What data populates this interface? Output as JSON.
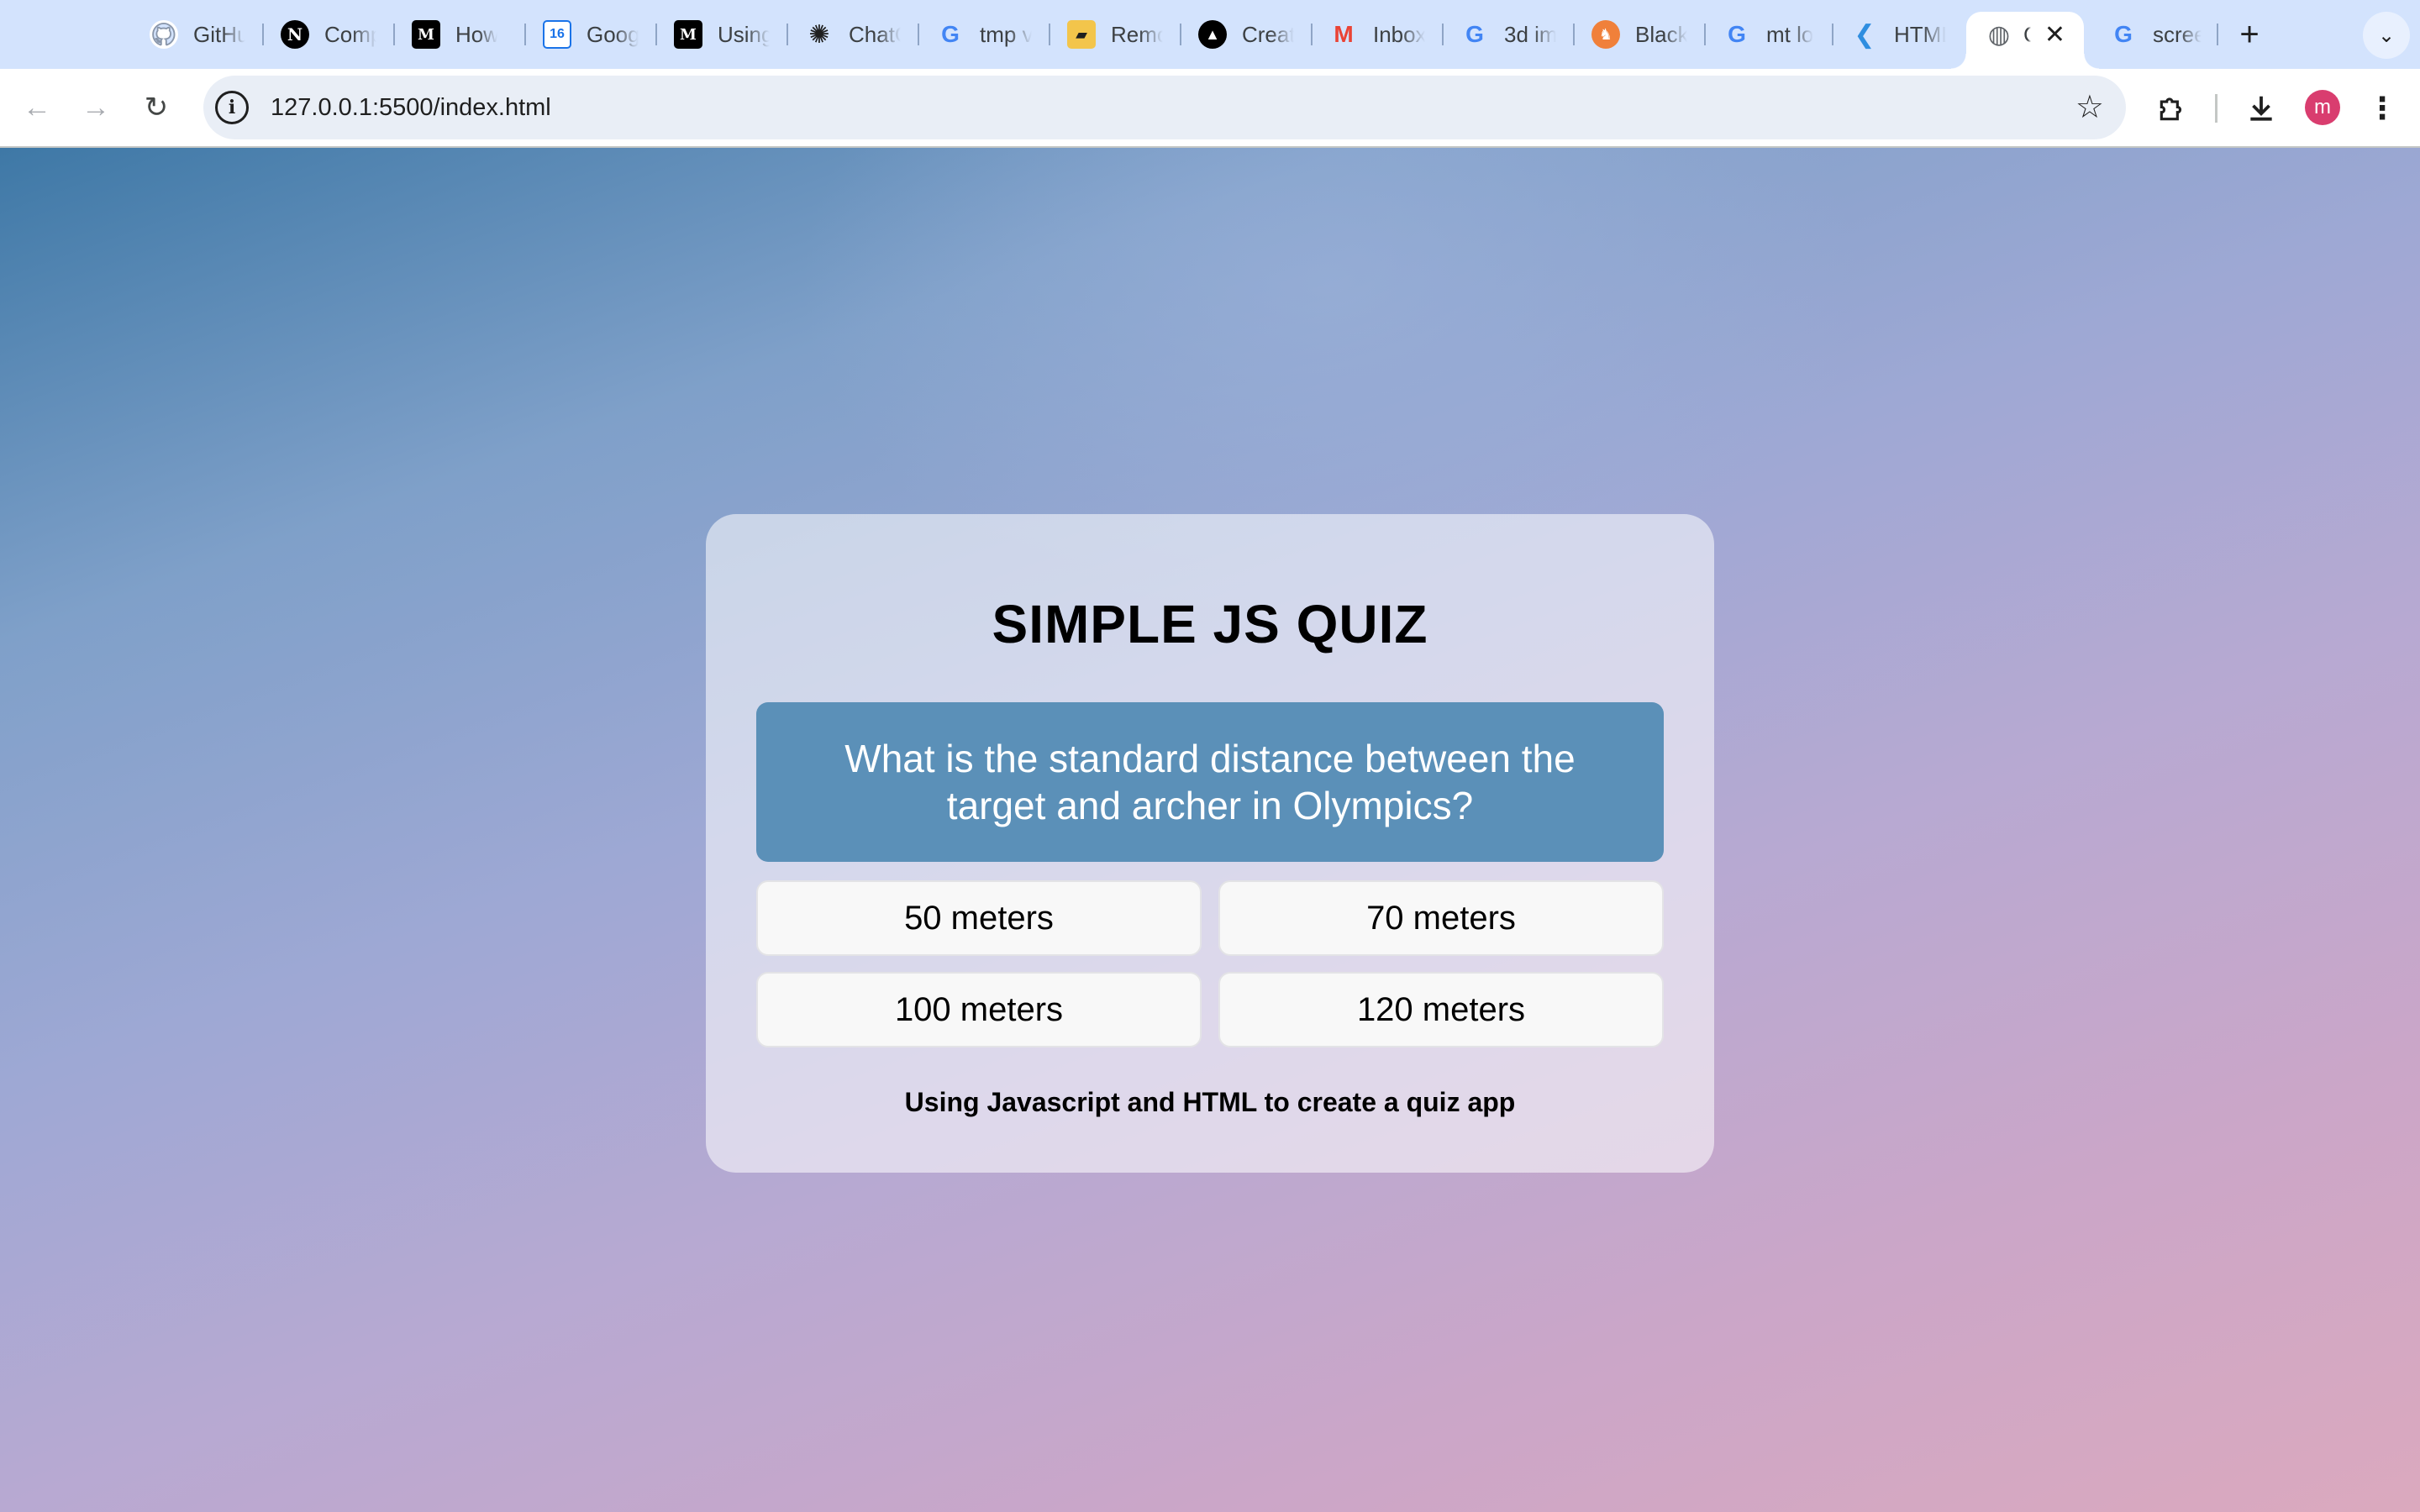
{
  "browser": {
    "tabs": [
      {
        "title": "GitHub",
        "icon": "github-icon",
        "color": "#ffffff",
        "bg": "#d3e3fd"
      },
      {
        "title": "Comp",
        "icon": "nextjs-icon",
        "color": "#ffffff",
        "bg": "#000000"
      },
      {
        "title": "How to",
        "icon": "medium-icon",
        "color": "#ffffff",
        "bg": "#000000"
      },
      {
        "title": "Google Calendar",
        "icon": "calendar-icon",
        "color": "#1a73e8",
        "bg": "#ffffff"
      },
      {
        "title": "Using",
        "icon": "medium-icon",
        "color": "#ffffff",
        "bg": "#000000"
      },
      {
        "title": "ChatGPT",
        "icon": "chatgpt-icon",
        "color": "#1f1f1f",
        "bg": "#d3e3fd"
      },
      {
        "title": "tmp v",
        "icon": "google-icon",
        "color": "#4285f4",
        "bg": "#d3e3fd"
      },
      {
        "title": "Remote",
        "icon": "remote-icon",
        "color": "#1f1f1f",
        "bg": "#f3c54b"
      },
      {
        "title": "Create",
        "icon": "vercel-icon",
        "color": "#ffffff",
        "bg": "#000000"
      },
      {
        "title": "Inbox",
        "icon": "gmail-icon",
        "color": "#ea4335",
        "bg": "#d3e3fd"
      },
      {
        "title": "3d im",
        "icon": "google-icon",
        "color": "#4285f4",
        "bg": "#d3e3fd"
      },
      {
        "title": "Black",
        "icon": "brave-icon",
        "color": "#ffffff",
        "bg": "#f0803a"
      },
      {
        "title": "mt lo",
        "icon": "google-icon",
        "color": "#4285f4",
        "bg": "#d3e3fd"
      },
      {
        "title": "HTML",
        "icon": "vscode-icon",
        "color": "#2f8ee0",
        "bg": "#d3e3fd"
      },
      {
        "title": "C",
        "icon": "globe-icon",
        "color": "#5f6368",
        "bg": "#ffffff",
        "active": true
      },
      {
        "title": "screen",
        "icon": "google-icon",
        "color": "#4285f4",
        "bg": "#d3e3fd"
      }
    ],
    "url": "127.0.0.1:5500/index.html",
    "profile_initial": "m",
    "profile_color": "#d93d6f"
  },
  "quiz": {
    "title": "SIMPLE JS QUIZ",
    "question": "What is the standard distance between the target and archer in Olympics?",
    "answers": [
      "50 meters",
      "70 meters",
      "100 meters",
      "120 meters"
    ],
    "footer": "Using Javascript and HTML to create a quiz app",
    "question_bg": "#5b90b8"
  }
}
